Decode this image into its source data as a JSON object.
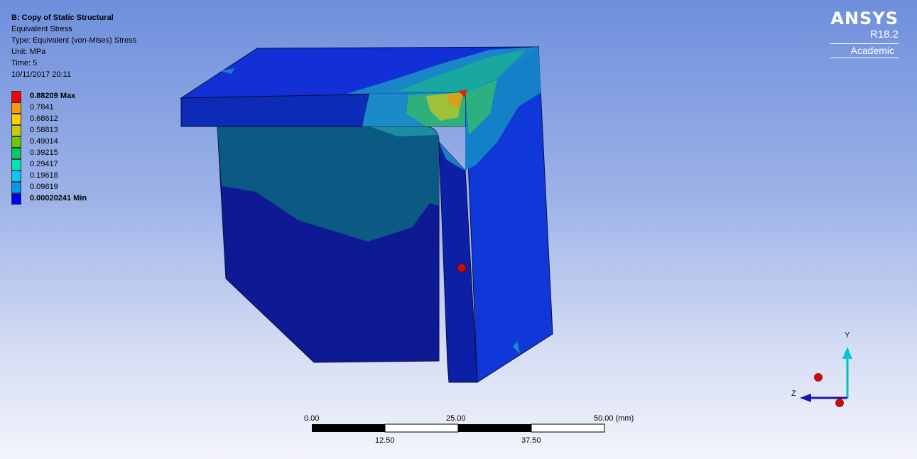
{
  "header": {
    "title": "B: Copy of Static Structural",
    "result": "Equivalent Stress",
    "type": "Type: Equivalent (von-Mises) Stress",
    "unit": "Unit: MPa",
    "time": "Time: 5",
    "date": "10/11/2017 20:11"
  },
  "legend": {
    "items": [
      {
        "label": "0.88209 Max",
        "color": "#ff0000",
        "bold": true
      },
      {
        "label": "0.7841",
        "color": "#ff9900",
        "bold": false
      },
      {
        "label": "0.68612",
        "color": "#ffcc00",
        "bold": false
      },
      {
        "label": "0.58813",
        "color": "#cccc00",
        "bold": false
      },
      {
        "label": "0.49014",
        "color": "#66cc00",
        "bold": false
      },
      {
        "label": "0.39215",
        "color": "#00cc66",
        "bold": false
      },
      {
        "label": "0.29417",
        "color": "#00e6b3",
        "bold": false
      },
      {
        "label": "0.19618",
        "color": "#00ccff",
        "bold": false
      },
      {
        "label": "0.09819",
        "color": "#0099e6",
        "bold": false
      },
      {
        "label": "0.00020241 Min",
        "color": "#0000ff",
        "bold": true
      }
    ]
  },
  "logo": {
    "brand": "ANSYS",
    "version": "R18.2",
    "edition": "Academic"
  },
  "scale_bar": {
    "labels_top": [
      "0.00",
      "25.00",
      "50.00 (mm)"
    ],
    "labels_bottom": [
      "12.50",
      "37.50"
    ]
  },
  "triad": {
    "y_label": "Y",
    "z_label": "Z"
  }
}
